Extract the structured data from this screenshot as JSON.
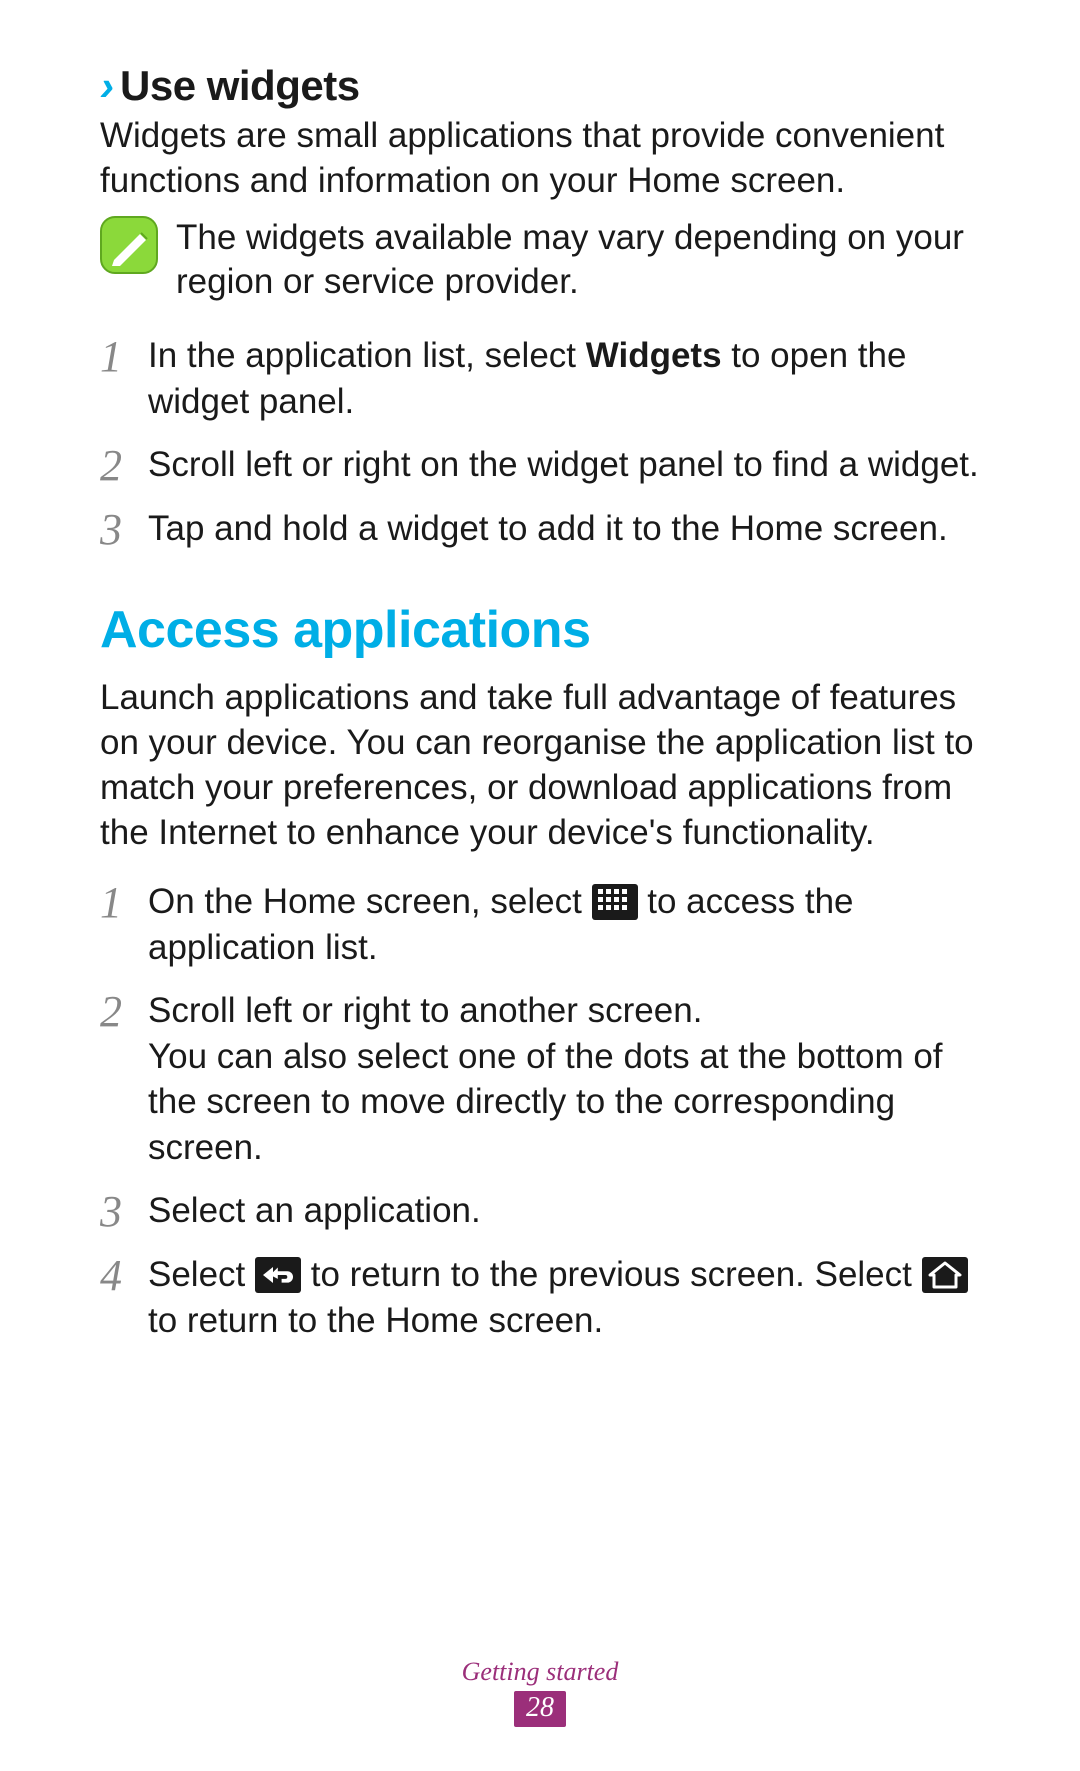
{
  "sub_heading": {
    "chevron": "›",
    "title": "Use widgets"
  },
  "widgets_intro": "Widgets are small applications that provide convenient functions and information on your Home screen.",
  "note_text": "The widgets available may vary depending on your region or service provider.",
  "steps_widgets": {
    "s1": {
      "num": "1",
      "pre": "In the application list, select ",
      "bold": "Widgets",
      "post": " to open the widget panel."
    },
    "s2": {
      "num": "2",
      "text": "Scroll left or right on the widget panel to find a widget."
    },
    "s3": {
      "num": "3",
      "text": "Tap and hold a widget to add it to the Home screen."
    }
  },
  "section_title": "Access applications",
  "apps_intro": "Launch applications and take full advantage of features on your device. You can reorganise the application list to match your preferences, or download applications from the Internet to enhance your device's functionality.",
  "steps_apps": {
    "s1": {
      "num": "1",
      "pre": "On the Home screen, select ",
      "post": " to access the application list."
    },
    "s2": {
      "num": "2",
      "line1": "Scroll left or right to another screen.",
      "line2": "You can also select one of the dots at the bottom of the screen to move directly to the corresponding screen."
    },
    "s3": {
      "num": "3",
      "text": "Select an application."
    },
    "s4": {
      "num": "4",
      "pre": "Select ",
      "mid": " to return to the previous screen. Select ",
      "post": " to return to the Home screen."
    }
  },
  "footer": {
    "label": "Getting started",
    "page": "28"
  }
}
